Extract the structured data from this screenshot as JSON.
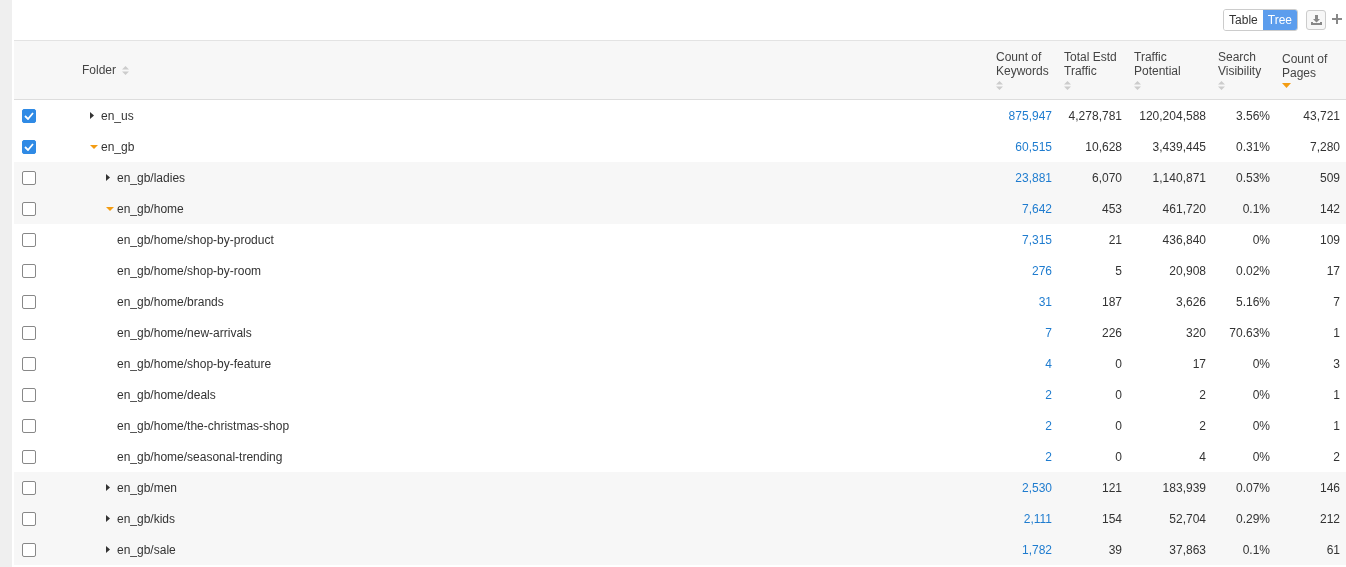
{
  "view_toggle": [
    {
      "label": "Table",
      "selected": false
    },
    {
      "label": "Tree",
      "selected": true
    }
  ],
  "columns": [
    {
      "label": "Folder",
      "sorted": false
    },
    {
      "label": "Count of Keywords",
      "sorted": false
    },
    {
      "label": "Total Estd Traffic",
      "sorted": false
    },
    {
      "label": "Traffic Potential",
      "sorted": false
    },
    {
      "label": "Search Visibility",
      "sorted": false
    },
    {
      "label": "Count of Pages",
      "sorted": true
    }
  ],
  "rows": [
    {
      "kind": "folder",
      "name": "en_us",
      "checked": true,
      "expanded": false,
      "keywords": "875,947",
      "traffic": "4,278,781",
      "potential": "120,204,588",
      "visibility": "3.56%",
      "pages": "43,721"
    },
    {
      "kind": "folder",
      "name": "en_gb",
      "checked": true,
      "expanded": true,
      "keywords": "60,515",
      "traffic": "10,628",
      "potential": "3,439,445",
      "visibility": "0.31%",
      "pages": "7,280",
      "children": [
        {
          "kind": "folder",
          "name": "en_gb/ladies",
          "checked": false,
          "expanded": false,
          "keywords": "23,881",
          "traffic": "6,070",
          "potential": "1,140,871",
          "visibility": "0.53%",
          "pages": "509"
        },
        {
          "kind": "folder",
          "name": "en_gb/home",
          "checked": false,
          "expanded": true,
          "keywords": "7,642",
          "traffic": "453",
          "potential": "461,720",
          "visibility": "0.1%",
          "pages": "142",
          "children": [
            {
              "kind": "leaf",
              "name": "en_gb/home/shop-by-product",
              "checked": false,
              "keywords": "7,315",
              "traffic": "21",
              "potential": "436,840",
              "visibility": "0%",
              "pages": "109"
            },
            {
              "kind": "leaf",
              "name": "en_gb/home/shop-by-room",
              "checked": false,
              "keywords": "276",
              "traffic": "5",
              "potential": "20,908",
              "visibility": "0.02%",
              "pages": "17"
            },
            {
              "kind": "leaf",
              "name": "en_gb/home/brands",
              "checked": false,
              "keywords": "31",
              "traffic": "187",
              "potential": "3,626",
              "visibility": "5.16%",
              "pages": "7"
            },
            {
              "kind": "leaf",
              "name": "en_gb/home/new-arrivals",
              "checked": false,
              "keywords": "7",
              "traffic": "226",
              "potential": "320",
              "visibility": "70.63%",
              "pages": "1"
            },
            {
              "kind": "leaf",
              "name": "en_gb/home/shop-by-feature",
              "checked": false,
              "keywords": "4",
              "traffic": "0",
              "potential": "17",
              "visibility": "0%",
              "pages": "3"
            },
            {
              "kind": "leaf",
              "name": "en_gb/home/deals",
              "checked": false,
              "keywords": "2",
              "traffic": "0",
              "potential": "2",
              "visibility": "0%",
              "pages": "1"
            },
            {
              "kind": "leaf",
              "name": "en_gb/home/the-christmas-shop",
              "checked": false,
              "keywords": "2",
              "traffic": "0",
              "potential": "2",
              "visibility": "0%",
              "pages": "1"
            },
            {
              "kind": "leaf",
              "name": "en_gb/home/seasonal-trending",
              "checked": false,
              "keywords": "2",
              "traffic": "0",
              "potential": "4",
              "visibility": "0%",
              "pages": "2"
            }
          ]
        },
        {
          "kind": "folder",
          "name": "en_gb/men",
          "checked": false,
          "expanded": false,
          "keywords": "2,530",
          "traffic": "121",
          "potential": "183,939",
          "visibility": "0.07%",
          "pages": "146"
        },
        {
          "kind": "folder",
          "name": "en_gb/kids",
          "checked": false,
          "expanded": false,
          "keywords": "2,111",
          "traffic": "154",
          "potential": "52,704",
          "visibility": "0.29%",
          "pages": "212"
        },
        {
          "kind": "folder",
          "name": "en_gb/sale",
          "checked": false,
          "expanded": false,
          "keywords": "1,782",
          "traffic": "39",
          "potential": "37,863",
          "visibility": "0.1%",
          "pages": "61"
        }
      ]
    }
  ]
}
